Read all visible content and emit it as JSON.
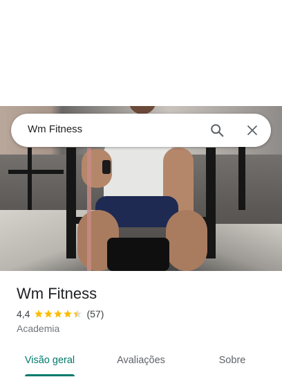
{
  "search": {
    "query": "Wm Fitness"
  },
  "icons": {
    "search": "search-icon",
    "close": "close-icon",
    "star": "star-icon"
  },
  "place": {
    "name": "Wm Fitness",
    "rating": "4,4",
    "rating_value": 4.4,
    "rating_max": 5,
    "review_count": "(57)",
    "category": "Academia"
  },
  "tabs": [
    {
      "label": "Visão geral",
      "active": true
    },
    {
      "label": "Avaliações",
      "active": false
    },
    {
      "label": "Sobre",
      "active": false
    }
  ],
  "colors": {
    "accent": "#00796b",
    "star": "#fbbc04",
    "star_empty": "#dadce0"
  }
}
